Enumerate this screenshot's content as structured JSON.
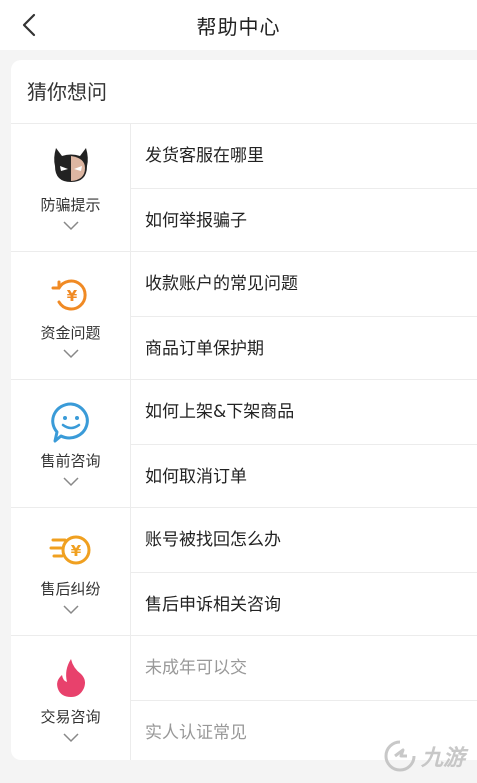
{
  "header": {
    "title": "帮助中心",
    "back_icon": "back-arrow-icon"
  },
  "card": {
    "title": "猜你想问"
  },
  "categories": [
    {
      "name": "防骗提示",
      "icon": "devil-icon",
      "questions": [
        "发货客服在哪里",
        "如何举报骗子"
      ]
    },
    {
      "name": "资金问题",
      "icon": "yuan-refresh-icon",
      "questions": [
        "收款账户的常见问题",
        "商品订单保护期"
      ]
    },
    {
      "name": "售前咨询",
      "icon": "smile-chat-icon",
      "questions": [
        "如何上架&下架商品",
        "如何取消订单"
      ]
    },
    {
      "name": "售后纠纷",
      "icon": "yuan-speed-icon",
      "questions": [
        "账号被找回怎么办",
        "售后申诉相关咨询"
      ]
    },
    {
      "name": "交易咨询",
      "icon": "flame-icon",
      "questions": [
        "未成年可以交",
        "实人认证常见"
      ]
    }
  ],
  "watermark": {
    "text": "九游"
  },
  "colors": {
    "accent_orange": "#f08a24",
    "blue": "#3a9bd8",
    "pink": "#e8416c"
  }
}
